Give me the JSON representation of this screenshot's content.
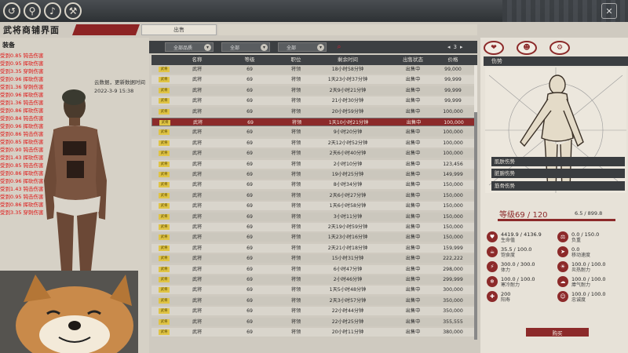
{
  "topbar": {
    "icons": [
      "compass-icon",
      "runner-icon",
      "whistle-icon",
      "axe-icon"
    ],
    "close": "✕"
  },
  "header": {
    "title": "武将商铺界面",
    "tab_sell": "出售"
  },
  "left": {
    "equip_label": "装备",
    "notice_line1": "云数据，更新数据时间",
    "notice_line2": "2022-3-9 15:38",
    "red_log": [
      "受到0.85 钝击伤害",
      "受到0.95 挥砍伤害",
      "受到3.35 穿刺伤害",
      "受到0.96 挥砍伤害",
      "受到1.36 穿刺伤害",
      "受到0.96 挥砍伤害",
      "受到1.36 钝击伤害",
      "受到0.86 挥砍伤害",
      "受到0.84 钝击伤害",
      "受到0.96 挥砍伤害",
      "受到0.86 钝击伤害",
      "受到0.85 挥砍伤害",
      "受到0.90 钝击伤害",
      "受到1.43 挥砍伤害",
      "受到0.85 钝击伤害",
      "受到0.86 挥砍伤害",
      "受到0.96 挥砍伤害",
      "受到1.43 钝击伤害",
      "受到0.95 钝击伤害",
      "受到0.86 挥砍伤害",
      "受到3.35 穿刺伤害"
    ]
  },
  "filter": {
    "select1": "全部品质",
    "select2": "全部",
    "select3": "全部",
    "page": "3"
  },
  "table": {
    "headers": [
      "名称",
      "等级",
      "职位",
      "剩余时间",
      "出售状态",
      "价格"
    ],
    "tag": "武将",
    "rows": [
      {
        "name": "武将",
        "level": "69",
        "role": "将领",
        "time": "18小时58分钟",
        "status": "出售中",
        "price": "99,000"
      },
      {
        "name": "武将",
        "level": "69",
        "role": "将领",
        "time": "1天23小时37分钟",
        "status": "出售中",
        "price": "99,999"
      },
      {
        "name": "武将",
        "level": "69",
        "role": "将领",
        "time": "2天9小时21分钟",
        "status": "出售中",
        "price": "99,999"
      },
      {
        "name": "武将",
        "level": "69",
        "role": "将领",
        "time": "21小时30分钟",
        "status": "出售中",
        "price": "99,999"
      },
      {
        "name": "武将",
        "level": "69",
        "role": "将领",
        "time": "20小时59分钟",
        "status": "出售中",
        "price": "100,000"
      },
      {
        "name": "武将",
        "level": "69",
        "role": "将领",
        "time": "1天10小时21分钟",
        "status": "出售中",
        "price": "100,000"
      },
      {
        "name": "武将",
        "level": "69",
        "role": "将领",
        "time": "9小时20分钟",
        "status": "出售中",
        "price": "100,000"
      },
      {
        "name": "武将",
        "level": "69",
        "role": "将领",
        "time": "2天12小时52分钟",
        "status": "出售中",
        "price": "100,000"
      },
      {
        "name": "武将",
        "level": "69",
        "role": "将领",
        "time": "2天6小时40分钟",
        "status": "出售中",
        "price": "100,000"
      },
      {
        "name": "武将",
        "level": "69",
        "role": "将领",
        "time": "2小时10分钟",
        "status": "出售中",
        "price": "123,456"
      },
      {
        "name": "武将",
        "level": "69",
        "role": "将领",
        "time": "19小时25分钟",
        "status": "出售中",
        "price": "149,999"
      },
      {
        "name": "武将",
        "level": "69",
        "role": "将领",
        "time": "8小时34分钟",
        "status": "出售中",
        "price": "150,000"
      },
      {
        "name": "武将",
        "level": "69",
        "role": "将领",
        "time": "2天6小时27分钟",
        "status": "出售中",
        "price": "150,000"
      },
      {
        "name": "武将",
        "level": "69",
        "role": "将领",
        "time": "1天6小时58分钟",
        "status": "出售中",
        "price": "150,000"
      },
      {
        "name": "武将",
        "level": "69",
        "role": "将领",
        "time": "3小时11分钟",
        "status": "出售中",
        "price": "150,000"
      },
      {
        "name": "武将",
        "level": "69",
        "role": "将领",
        "time": "2天19小时59分钟",
        "status": "出售中",
        "price": "150,000"
      },
      {
        "name": "武将",
        "level": "69",
        "role": "将领",
        "time": "1天23小时16分钟",
        "status": "出售中",
        "price": "150,000"
      },
      {
        "name": "武将",
        "level": "69",
        "role": "将领",
        "time": "2天21小时18分钟",
        "status": "出售中",
        "price": "159,999"
      },
      {
        "name": "武将",
        "level": "69",
        "role": "将领",
        "time": "15小时31分钟",
        "status": "出售中",
        "price": "222,222"
      },
      {
        "name": "武将",
        "level": "69",
        "role": "将领",
        "time": "6小时47分钟",
        "status": "出售中",
        "price": "298,000"
      },
      {
        "name": "武将",
        "level": "69",
        "role": "将领",
        "time": "2小时46分钟",
        "status": "出售中",
        "price": "299,999"
      },
      {
        "name": "武将",
        "level": "69",
        "role": "将领",
        "time": "1天5小时48分钟",
        "status": "出售中",
        "price": "300,000"
      },
      {
        "name": "武将",
        "level": "69",
        "role": "将领",
        "time": "2天3小时57分钟",
        "status": "出售中",
        "price": "350,000"
      },
      {
        "name": "武将",
        "level": "69",
        "role": "将领",
        "time": "22小时44分钟",
        "status": "出售中",
        "price": "350,000"
      },
      {
        "name": "武将",
        "level": "69",
        "role": "将领",
        "time": "22小时25分钟",
        "status": "出售中",
        "price": "355,555"
      },
      {
        "name": "武将",
        "level": "69",
        "role": "将领",
        "time": "20小时11分钟",
        "status": "出售中",
        "price": "380,000"
      }
    ],
    "selected_index": 5
  },
  "right": {
    "title": "伤势",
    "injuries": [
      "肌肤伤势",
      "脏腑伤势",
      "筋骨伤势"
    ],
    "level": "等级69 / 120",
    "exp": "6.5 / 899.8",
    "stats": [
      {
        "value": "4419.9 / 4136.9",
        "label": "生命值",
        "icon": "heart-icon"
      },
      {
        "value": "0.0 / 150.0",
        "label": "负重",
        "icon": "weight-icon"
      },
      {
        "value": "35.5 / 100.0",
        "label": "饱食度",
        "icon": "food-icon"
      },
      {
        "value": "0.0",
        "label": "移动速度",
        "icon": "speed-icon"
      },
      {
        "value": "300.0 / 300.0",
        "label": "体力",
        "icon": "stamina-icon"
      },
      {
        "value": "100.0 / 100.0",
        "label": "炎热耐力",
        "icon": "heat-icon"
      },
      {
        "value": "100.0 / 100.0",
        "label": "寒冷耐力",
        "icon": "cold-icon"
      },
      {
        "value": "100.0 / 100.0",
        "label": "瘴气耐力",
        "icon": "miasma-icon"
      },
      {
        "value": "200",
        "label": "阳寿",
        "icon": "life-icon"
      },
      {
        "value": "100.0 / 100.0",
        "label": "忠诚度",
        "icon": "loyalty-icon"
      }
    ],
    "buy": "购买"
  }
}
